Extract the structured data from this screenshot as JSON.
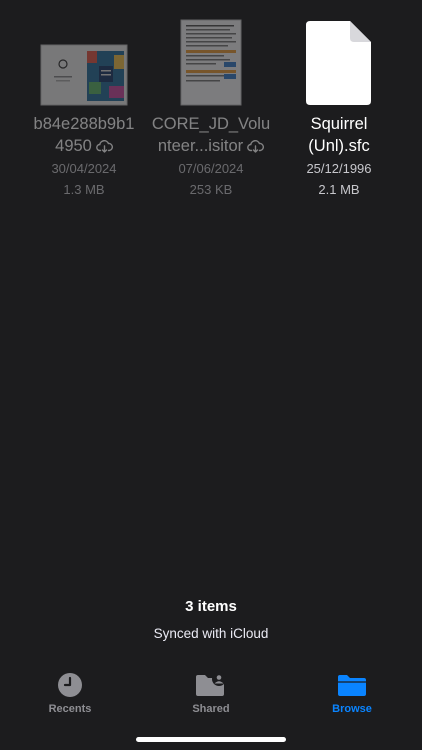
{
  "files": [
    {
      "name_line1": "b84e288b9b1",
      "name_line2": "4950",
      "date": "30/04/2024",
      "size": "1.3 MB",
      "icon": "cloud-download-icon"
    },
    {
      "name_line1": "CORE_JD_Volu",
      "name_line2": "nteer...isitor",
      "date": "07/06/2024",
      "size": "253 KB",
      "icon": "cloud-download-icon"
    },
    {
      "name_line1": "Squirrel",
      "name_line2": "(Unl).sfc",
      "date": "25/12/1996",
      "size": "2.1 MB",
      "icon": "generic-document-icon"
    }
  ],
  "footer": {
    "item_count": "3 items",
    "sync_status": "Synced with iCloud"
  },
  "tabbar": {
    "tabs": [
      {
        "label": "Recents",
        "icon": "clock-icon",
        "active": false
      },
      {
        "label": "Shared",
        "icon": "shared-folder-icon",
        "active": false
      },
      {
        "label": "Browse",
        "icon": "folder-icon",
        "active": true
      }
    ],
    "active_color": "#0a84ff",
    "inactive_color": "#8e8e93"
  },
  "background": "#1c1c1e"
}
